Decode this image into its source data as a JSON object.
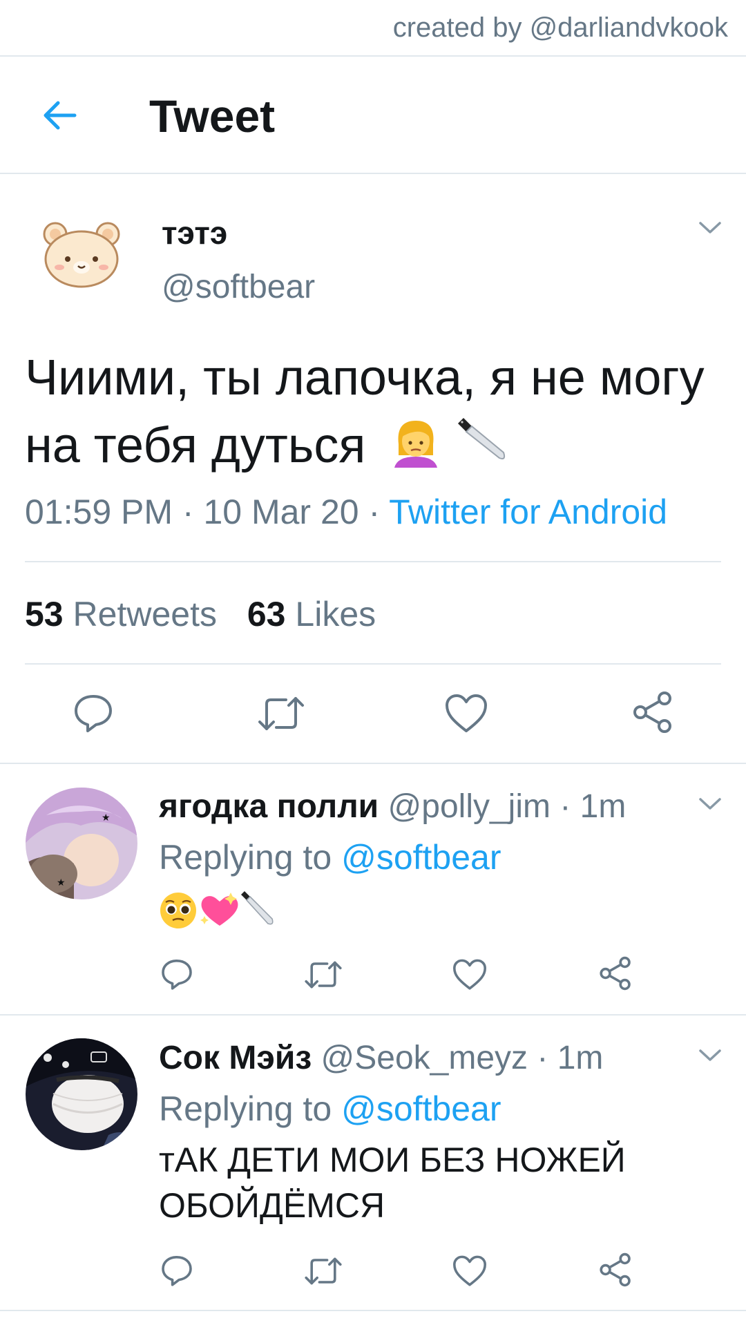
{
  "credit": "created by @darliandvkook",
  "header": {
    "title": "Tweet"
  },
  "tweet": {
    "name": "тэтэ",
    "handle": "@softbear",
    "text": "Чиими, ты лапочка, я не могу на тебя дуться",
    "time": "01:59 PM",
    "date": "10 Mar 20",
    "separator": " · ",
    "source": "Twitter for Android",
    "retweets_count": "53",
    "retweets_label": "Retweets",
    "likes_count": "63",
    "likes_label": "Likes"
  },
  "replies": [
    {
      "name": "ягодка полли",
      "handle": "@polly_jim",
      "time": "1m",
      "replying_label": "Replying to",
      "replying_to": "@softbear",
      "text": ""
    },
    {
      "name": "Сок Мэйз",
      "handle": "@Seok_meyz",
      "time": "1m",
      "replying_label": "Replying to",
      "replying_to": "@softbear",
      "text": "тАК ДЕТИ МОИ БЕЗ НОЖЕЙ ОБОЙДЁМСЯ"
    }
  ],
  "icons": {
    "back": "arrow-left-icon",
    "reply": "speech-bubble-icon",
    "retweet": "retweet-arrows-icon",
    "like": "heart-icon",
    "share": "share-nodes-icon",
    "more": "chevron-down-icon"
  },
  "colors": {
    "accent": "#1da1f2",
    "secondary_text": "#657786",
    "divider": "#e1e8ed"
  }
}
